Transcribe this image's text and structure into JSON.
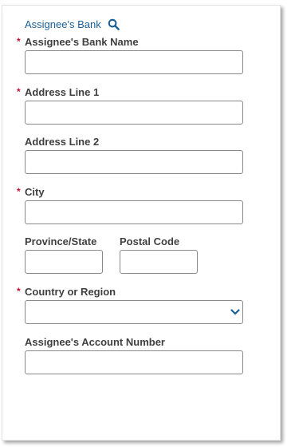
{
  "header": {
    "label": "Assignee's Bank",
    "icon": "search-icon"
  },
  "fields": {
    "bank_name": {
      "label": "Assignee's Bank Name",
      "required": true,
      "value": "",
      "required_marker": "*"
    },
    "address1": {
      "label": "Address Line 1",
      "required": true,
      "value": "",
      "required_marker": "*"
    },
    "address2": {
      "label": "Address Line 2",
      "required": false,
      "value": ""
    },
    "city": {
      "label": "City",
      "required": true,
      "value": "",
      "required_marker": "*"
    },
    "province": {
      "label": "Province/State",
      "required": false,
      "value": ""
    },
    "postal": {
      "label": "Postal Code",
      "required": false,
      "value": ""
    },
    "country": {
      "label": "Country or Region",
      "required": true,
      "value": "",
      "required_marker": "*",
      "icon": "chevron-down-icon"
    },
    "account_number": {
      "label": "Assignee's Account Number",
      "required": false,
      "value": ""
    }
  },
  "colors": {
    "accent": "#1b5f95",
    "required": "#c8102e",
    "border": "#8a8a8a"
  }
}
